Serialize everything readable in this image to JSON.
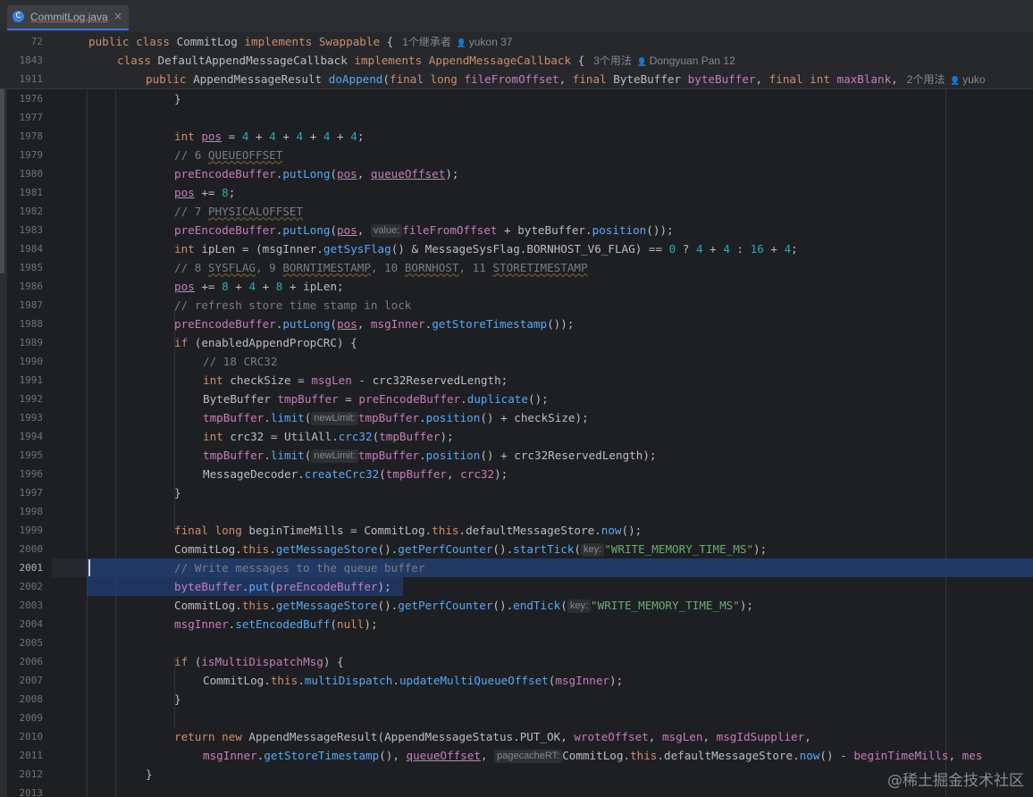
{
  "tab": {
    "label": "CommitLog.java",
    "close": "×",
    "icon": "C"
  },
  "sticky": [
    {
      "ln": "72",
      "code": [
        [
          "kw",
          "public "
        ],
        [
          "kw",
          "class "
        ],
        [
          "ty",
          "CommitLog "
        ],
        [
          "kw",
          "implements "
        ],
        [
          "kw",
          "Swappable "
        ],
        [
          "op",
          "{"
        ]
      ],
      "meta": "1个继承者",
      "person": "yukon 37"
    },
    {
      "ln": "1843",
      "code": [
        [
          "kw",
          "class "
        ],
        [
          "ty",
          "DefaultAppendMessageCallback "
        ],
        [
          "kw",
          "implements "
        ],
        [
          "kw",
          "AppendMessageCallback "
        ],
        [
          "op",
          "{"
        ]
      ],
      "meta": "3个用法",
      "person": "Dongyuan Pan 12"
    },
    {
      "ln": "1911",
      "code": [
        [
          "kw",
          "public "
        ],
        [
          "ty",
          "AppendMessageResult "
        ],
        [
          "fn",
          "doAppend"
        ],
        [
          "op",
          "("
        ],
        [
          "kw",
          "final "
        ],
        [
          "kw",
          "long "
        ],
        [
          "loc",
          "fileFromOffset"
        ],
        [
          "op",
          ", "
        ],
        [
          "kw",
          "final "
        ],
        [
          "ty",
          "ByteBuffer "
        ],
        [
          "loc",
          "byteBuffer"
        ],
        [
          "op",
          ", "
        ],
        [
          "kw",
          "final "
        ],
        [
          "kw",
          "int "
        ],
        [
          "loc",
          "maxBlank"
        ],
        [
          "op",
          ","
        ]
      ],
      "meta": "2个用法",
      "person": "yuko"
    }
  ],
  "lines": [
    {
      "ln": "1976",
      "code": [
        [
          "op",
          "}"
        ]
      ]
    },
    {
      "ln": "1977",
      "code": []
    },
    {
      "ln": "1978",
      "code": [
        [
          "kw",
          "int "
        ],
        [
          "var",
          "pos"
        ],
        [
          "op",
          " = "
        ],
        [
          "num",
          "4"
        ],
        [
          "op",
          " + "
        ],
        [
          "num",
          "4"
        ],
        [
          "op",
          " + "
        ],
        [
          "num",
          "4"
        ],
        [
          "op",
          " + "
        ],
        [
          "num",
          "4"
        ],
        [
          "op",
          " + "
        ],
        [
          "num",
          "4"
        ],
        [
          "op",
          ";"
        ]
      ]
    },
    {
      "ln": "1979",
      "code": [
        [
          "cm",
          "// 6 QUEUEOFFSET"
        ]
      ]
    },
    {
      "ln": "1980",
      "code": [
        [
          "fld",
          "preEncodeBuffer"
        ],
        [
          "op",
          "."
        ],
        [
          "mth",
          "putLong"
        ],
        [
          "op",
          "("
        ],
        [
          "var",
          "pos"
        ],
        [
          "op",
          ", "
        ],
        [
          "fld",
          "queueOffset"
        ],
        [
          "op",
          ");"
        ]
      ]
    },
    {
      "ln": "1981",
      "code": [
        [
          "var",
          "pos"
        ],
        [
          "op",
          " += "
        ],
        [
          "num",
          "8"
        ],
        [
          "op",
          ";"
        ]
      ]
    },
    {
      "ln": "1982",
      "code": [
        [
          "cm",
          "// 7 PHYSICALOFFSET"
        ]
      ]
    },
    {
      "ln": "1983",
      "code": [
        [
          "fld",
          "preEncodeBuffer"
        ],
        [
          "op",
          "."
        ],
        [
          "mth",
          "putLong"
        ],
        [
          "op",
          "("
        ],
        [
          "var",
          "pos"
        ],
        [
          "op",
          ", "
        ],
        [
          "hint",
          "value:"
        ],
        [
          "loc",
          "fileFromOffset"
        ],
        [
          "op",
          " + "
        ],
        [
          "ty",
          "byteBuffer"
        ],
        [
          "op",
          "."
        ],
        [
          "mth",
          "position"
        ],
        [
          "op",
          "());"
        ]
      ]
    },
    {
      "ln": "1984",
      "code": [
        [
          "kw",
          "int "
        ],
        [
          "ty",
          "ipLen"
        ],
        [
          "op",
          " = ("
        ],
        [
          "ty",
          "msgInner"
        ],
        [
          "op",
          "."
        ],
        [
          "mth",
          "getSysFlag"
        ],
        [
          "op",
          "() & "
        ],
        [
          "ty",
          "MessageSysFlag"
        ],
        [
          "op",
          "."
        ],
        [
          "ty",
          "BORNHOST_V6_FLAG"
        ],
        [
          "op",
          ") == "
        ],
        [
          "num",
          "0"
        ],
        [
          "op",
          " ? "
        ],
        [
          "num",
          "4"
        ],
        [
          "op",
          " + "
        ],
        [
          "num",
          "4"
        ],
        [
          "op",
          " : "
        ],
        [
          "num",
          "16"
        ],
        [
          "op",
          " + "
        ],
        [
          "num",
          "4"
        ],
        [
          "op",
          ";"
        ]
      ]
    },
    {
      "ln": "1985",
      "code": [
        [
          "cm",
          "// 8 SYSFLAG, 9 BORNTIMESTAMP, 10 BORNHOST, 11 STORETIMESTAMP"
        ]
      ]
    },
    {
      "ln": "1986",
      "code": [
        [
          "var",
          "pos"
        ],
        [
          "op",
          " += "
        ],
        [
          "num",
          "8"
        ],
        [
          "op",
          " + "
        ],
        [
          "num",
          "4"
        ],
        [
          "op",
          " + "
        ],
        [
          "num",
          "8"
        ],
        [
          "op",
          " + "
        ],
        [
          "ty",
          "ipLen"
        ],
        [
          "op",
          ";"
        ]
      ]
    },
    {
      "ln": "1987",
      "code": [
        [
          "cm",
          "// refresh store time stamp in lock"
        ]
      ]
    },
    {
      "ln": "1988",
      "code": [
        [
          "fld",
          "preEncodeBuffer"
        ],
        [
          "op",
          "."
        ],
        [
          "mth",
          "putLong"
        ],
        [
          "op",
          "("
        ],
        [
          "var",
          "pos"
        ],
        [
          "op",
          ", "
        ],
        [
          "fld",
          "msgInner"
        ],
        [
          "op",
          "."
        ],
        [
          "mth",
          "getStoreTimestamp"
        ],
        [
          "op",
          "());"
        ]
      ]
    },
    {
      "ln": "1989",
      "code": [
        [
          "kw",
          "if "
        ],
        [
          "op",
          "(enabledAppendPropCRC) {"
        ]
      ]
    },
    {
      "ln": "1990",
      "code": [
        [
          "cm",
          "// 18 CRC32"
        ]
      ]
    },
    {
      "ln": "1991",
      "code": [
        [
          "kw",
          "int "
        ],
        [
          "ty",
          "checkSize"
        ],
        [
          "op",
          " = "
        ],
        [
          "fld",
          "msgLen"
        ],
        [
          "op",
          " - crc32ReservedLength;"
        ]
      ]
    },
    {
      "ln": "1992",
      "code": [
        [
          "ty",
          "ByteBuffer "
        ],
        [
          "fld",
          "tmpBuffer"
        ],
        [
          "op",
          " = "
        ],
        [
          "fld",
          "preEncodeBuffer"
        ],
        [
          "op",
          "."
        ],
        [
          "mth",
          "duplicate"
        ],
        [
          "op",
          "();"
        ]
      ]
    },
    {
      "ln": "1993",
      "code": [
        [
          "fld",
          "tmpBuffer"
        ],
        [
          "op",
          "."
        ],
        [
          "mth",
          "limit"
        ],
        [
          "op",
          "("
        ],
        [
          "hint",
          "newLimit:"
        ],
        [
          "fld",
          "tmpBuffer"
        ],
        [
          "op",
          "."
        ],
        [
          "mth",
          "position"
        ],
        [
          "op",
          "() + "
        ],
        [
          "ty",
          "checkSize"
        ],
        [
          "op",
          ");"
        ]
      ]
    },
    {
      "ln": "1994",
      "code": [
        [
          "kw",
          "int "
        ],
        [
          "ty",
          "crc32"
        ],
        [
          "op",
          " = UtilAll."
        ],
        [
          "mth",
          "crc32"
        ],
        [
          "op",
          "("
        ],
        [
          "fld",
          "tmpBuffer"
        ],
        [
          "op",
          ");"
        ]
      ]
    },
    {
      "ln": "1995",
      "code": [
        [
          "fld",
          "tmpBuffer"
        ],
        [
          "op",
          "."
        ],
        [
          "mth",
          "limit"
        ],
        [
          "op",
          "("
        ],
        [
          "hint",
          "newLimit:"
        ],
        [
          "fld",
          "tmpBuffer"
        ],
        [
          "op",
          "."
        ],
        [
          "mth",
          "position"
        ],
        [
          "op",
          "() + crc32ReservedLength);"
        ]
      ]
    },
    {
      "ln": "1996",
      "code": [
        [
          "ty",
          "MessageDecoder"
        ],
        [
          "op",
          "."
        ],
        [
          "mth",
          "createCrc32"
        ],
        [
          "op",
          "("
        ],
        [
          "fld",
          "tmpBuffer"
        ],
        [
          "op",
          ", "
        ],
        [
          "fld",
          "crc32"
        ],
        [
          "op",
          ");"
        ]
      ]
    },
    {
      "ln": "1997",
      "code": [
        [
          "op",
          "}"
        ]
      ]
    },
    {
      "ln": "1998",
      "code": []
    },
    {
      "ln": "1999",
      "code": [
        [
          "kw",
          "final "
        ],
        [
          "kw",
          "long "
        ],
        [
          "ty",
          "beginTimeMills"
        ],
        [
          "op",
          " = CommitLog."
        ],
        [
          "kw",
          "this"
        ],
        [
          "op",
          "."
        ],
        [
          "ty",
          "defaultMessageStore"
        ],
        [
          "op",
          "."
        ],
        [
          "mth",
          "now"
        ],
        [
          "op",
          "();"
        ]
      ]
    },
    {
      "ln": "2000",
      "code": [
        [
          "ty",
          "CommitLog"
        ],
        [
          "op",
          "."
        ],
        [
          "kw",
          "this"
        ],
        [
          "op",
          "."
        ],
        [
          "mth",
          "getMessageStore"
        ],
        [
          "op",
          "()."
        ],
        [
          "mth",
          "getPerfCounter"
        ],
        [
          "op",
          "()."
        ],
        [
          "mth",
          "startTick"
        ],
        [
          "op",
          "("
        ],
        [
          "hint",
          "key:"
        ],
        [
          "str",
          "\"WRITE_MEMORY_TIME_MS\""
        ],
        [
          "op",
          ");"
        ]
      ]
    },
    {
      "ln": "2001",
      "code": [
        [
          "cm",
          "// Write messages to the queue buffer"
        ]
      ]
    },
    {
      "ln": "2002",
      "code": [
        [
          "fld",
          "byteBuffer"
        ],
        [
          "op",
          "."
        ],
        [
          "mth",
          "put"
        ],
        [
          "op",
          "("
        ],
        [
          "fld",
          "preEncodeBuffer"
        ],
        [
          "op",
          ");"
        ]
      ]
    },
    {
      "ln": "2003",
      "code": [
        [
          "ty",
          "CommitLog"
        ],
        [
          "op",
          "."
        ],
        [
          "kw",
          "this"
        ],
        [
          "op",
          "."
        ],
        [
          "mth",
          "getMessageStore"
        ],
        [
          "op",
          "()."
        ],
        [
          "mth",
          "getPerfCounter"
        ],
        [
          "op",
          "()."
        ],
        [
          "mth",
          "endTick"
        ],
        [
          "op",
          "("
        ],
        [
          "hint",
          "key:"
        ],
        [
          "str",
          "\"WRITE_MEMORY_TIME_MS\""
        ],
        [
          "op",
          ");"
        ]
      ]
    },
    {
      "ln": "2004",
      "code": [
        [
          "fld",
          "msgInner"
        ],
        [
          "op",
          "."
        ],
        [
          "mth",
          "setEncodedBuff"
        ],
        [
          "op",
          "("
        ],
        [
          "kw",
          "null"
        ],
        [
          "op",
          ");"
        ]
      ]
    },
    {
      "ln": "2005",
      "code": []
    },
    {
      "ln": "2006",
      "code": [
        [
          "kw",
          "if "
        ],
        [
          "op",
          "("
        ],
        [
          "fld",
          "isMultiDispatchMsg"
        ],
        [
          "op",
          ") {"
        ]
      ]
    },
    {
      "ln": "2007",
      "code": [
        [
          "ty",
          "CommitLog"
        ],
        [
          "op",
          "."
        ],
        [
          "kw",
          "this"
        ],
        [
          "op",
          "."
        ],
        [
          "mth",
          "multiDispatch"
        ],
        [
          "op",
          "."
        ],
        [
          "mth",
          "updateMultiQueueOffset"
        ],
        [
          "op",
          "("
        ],
        [
          "fld",
          "msgInner"
        ],
        [
          "op",
          ");"
        ]
      ]
    },
    {
      "ln": "2008",
      "code": [
        [
          "op",
          "}"
        ]
      ]
    },
    {
      "ln": "2009",
      "code": []
    },
    {
      "ln": "2010",
      "code": [
        [
          "kw",
          "return "
        ],
        [
          "kw",
          "new "
        ],
        [
          "ty",
          "AppendMessageResult"
        ],
        [
          "op",
          "(AppendMessageStatus.PUT_OK, "
        ],
        [
          "fld",
          "wroteOffset"
        ],
        [
          "op",
          ", "
        ],
        [
          "fld",
          "msgLen"
        ],
        [
          "op",
          ", "
        ],
        [
          "fld",
          "msgIdSupplier"
        ],
        [
          "op",
          ","
        ]
      ]
    },
    {
      "ln": "2011",
      "code": [
        [
          "fld",
          "msgInner"
        ],
        [
          "op",
          "."
        ],
        [
          "mth",
          "getStoreTimestamp"
        ],
        [
          "op",
          "(), "
        ],
        [
          "fld",
          "queueOffset"
        ],
        [
          "op",
          ", "
        ],
        [
          "hint",
          "pagecacheRT:"
        ],
        [
          "ty",
          "CommitLog"
        ],
        [
          "op",
          "."
        ],
        [
          "kw",
          "this"
        ],
        [
          "op",
          "."
        ],
        [
          "ty",
          "defaultMessageStore"
        ],
        [
          "op",
          "."
        ],
        [
          "mth",
          "now"
        ],
        [
          "op",
          "() - "
        ],
        [
          "fld",
          "beginTimeMills"
        ],
        [
          "op",
          ", "
        ],
        [
          "fld",
          "mes"
        ]
      ]
    },
    {
      "ln": "2012",
      "code": [
        [
          "op",
          "}"
        ]
      ]
    },
    {
      "ln": "2013",
      "code": []
    }
  ],
  "watermark": "@稀土掘金技术社区"
}
